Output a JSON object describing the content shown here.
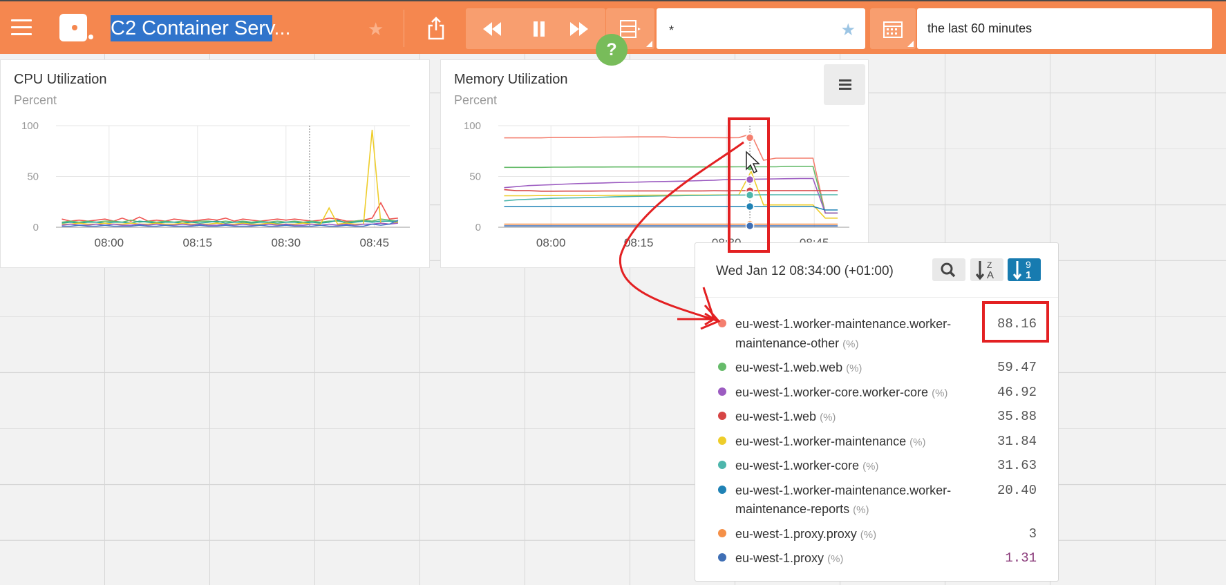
{
  "header": {
    "title": "C2 Container Serv...",
    "filter_query": "*",
    "time_range": "the last 60 minutes",
    "help_label": "?"
  },
  "icons": {
    "menu": "hamburger-menu-icon",
    "logo": "app-logo-icon",
    "favorite": "star-icon",
    "share": "share-icon",
    "rewind": "rewind-icon",
    "pause": "pause-icon",
    "forward": "fast-forward-icon",
    "filter": "filter-panel-icon",
    "calendar": "calendar-icon",
    "search": "search-icon",
    "sort_alpha": "sort-alpha-desc-icon",
    "sort_numeric": "sort-numeric-desc-icon"
  },
  "colors": {
    "topbar": "#f5874f",
    "accent_blue": "#177bb0",
    "annotation_red": "#e32022",
    "help_green": "#78bc5a"
  },
  "panels": [
    {
      "title": "CPU Utilization",
      "subtitle": "Percent",
      "chart_data": {
        "type": "line",
        "y_ticks": [
          "100",
          "50",
          "0"
        ],
        "x_ticks": [
          "08:00",
          "08:15",
          "08:30",
          "08:45"
        ],
        "ylim": [
          0,
          100
        ],
        "x_range": [
          "07:51",
          "08:51"
        ],
        "grid": true,
        "legend": "none",
        "hover_time": "08:34",
        "series": [
          {
            "color": "#ef5350",
            "values": [
              8,
              6,
              7,
              6,
              7,
              8,
              6,
              9,
              6,
              10,
              6,
              7,
              6,
              8,
              7,
              6,
              7,
              8,
              7,
              9,
              6,
              8,
              7,
              6,
              7,
              8,
              7,
              8,
              7,
              6,
              7,
              9,
              8,
              6,
              6,
              7,
              9,
              24,
              8,
              9
            ]
          },
          {
            "color": "#66bb6a",
            "values": [
              5,
              6,
              5,
              6,
              5,
              6,
              6,
              5,
              7,
              5,
              6,
              5,
              6,
              5,
              6,
              5,
              6,
              6,
              5,
              6,
              5,
              6,
              5,
              6,
              5,
              6,
              5,
              6,
              5,
              6,
              5,
              6,
              6,
              5,
              6,
              7,
              6,
              8,
              7,
              6
            ]
          },
          {
            "color": "#26a69a",
            "values": [
              4,
              5,
              4,
              5,
              5,
              4,
              5,
              5,
              4,
              6,
              5,
              4,
              5,
              5,
              4,
              5,
              4,
              5,
              6,
              4,
              5,
              5,
              4,
              5,
              5,
              4,
              5,
              5,
              4,
              5,
              4,
              5,
              7,
              4,
              5,
              6,
              5,
              6,
              6,
              5
            ]
          },
          {
            "color": "#eecd2a",
            "values": [
              3,
              3,
              4,
              3,
              3,
              4,
              3,
              3,
              4,
              3,
              3,
              4,
              3,
              3,
              4,
              3,
              3,
              3,
              4,
              3,
              3,
              4,
              3,
              3,
              4,
              3,
              3,
              3,
              4,
              3,
              3,
              19,
              3,
              4,
              3,
              3,
              96,
              4,
              3,
              5
            ]
          },
          {
            "color": "#9c5cc1",
            "values": [
              2,
              3,
              2,
              2,
              3,
              2,
              3,
              2,
              2,
              3,
              2,
              3,
              2,
              2,
              3,
              2,
              3,
              2,
              2,
              3,
              2,
              3,
              2,
              2,
              3,
              2,
              3,
              2,
              2,
              3,
              2,
              3,
              2,
              3,
              2,
              3,
              3,
              4,
              3,
              4
            ]
          },
          {
            "color": "#4a79c9",
            "values": [
              1,
              1,
              2,
              1,
              1,
              2,
              1,
              1,
              1,
              2,
              1,
              1,
              2,
              1,
              1,
              1,
              2,
              1,
              1,
              2,
              1,
              1,
              1,
              2,
              1,
              1,
              2,
              1,
              1,
              1,
              2,
              1,
              1,
              2,
              1,
              1,
              3,
              2,
              3,
              7
            ]
          }
        ]
      }
    },
    {
      "title": "Memory Utilization",
      "subtitle": "Percent",
      "chart_data": {
        "type": "line",
        "y_ticks": [
          "100",
          "50",
          "0"
        ],
        "x_ticks": [
          "08:00",
          "08:15",
          "08:30",
          "08:45"
        ],
        "ylim": [
          0,
          100
        ],
        "x_range": [
          "07:51",
          "08:51"
        ],
        "grid": true,
        "legend": "none",
        "hover_time": "08:34",
        "series": [
          {
            "color": "#f47f6f",
            "values": [
              88,
              88,
              88,
              88,
              88.5,
              88.5,
              88.5,
              88.5,
              88.8,
              88.8,
              88.9,
              89,
              89,
              89,
              88.2,
              88.2,
              88.2,
              88.2,
              88.16,
              88.2,
              92,
              66,
              68,
              68,
              68,
              68,
              14,
              14
            ]
          },
          {
            "color": "#66bb6a",
            "values": [
              59,
              59,
              59,
              59,
              59.2,
              59.2,
              59.3,
              59.3,
              59.3,
              59.4,
              59.4,
              59.4,
              59.4,
              59.4,
              59.4,
              59.4,
              59.4,
              59.4,
              59.47,
              59.5,
              59.5,
              59.5,
              59.5,
              60,
              60,
              60,
              14,
              14
            ]
          },
          {
            "color": "#9c5cc1",
            "values": [
              39,
              40,
              41,
              41.5,
              42,
              42.5,
              43,
              43.3,
              43.6,
              44,
              44.2,
              44.5,
              44.8,
              45,
              45.3,
              45.6,
              46,
              46.3,
              46.92,
              47,
              47.2,
              47.4,
              47.6,
              47.8,
              48,
              48,
              14,
              14
            ]
          },
          {
            "color": "#d64545",
            "values": [
              37,
              36,
              36,
              35.5,
              35.5,
              35.6,
              35.6,
              35.6,
              35.7,
              35.7,
              35.7,
              35.8,
              35.8,
              35.8,
              35.8,
              35.8,
              35.8,
              35.9,
              35.88,
              36,
              36,
              36,
              36,
              36,
              36,
              36,
              36,
              36
            ]
          },
          {
            "color": "#eecd2a",
            "values": [
              31,
              31,
              31,
              31.2,
              31.2,
              31.3,
              31.3,
              31.4,
              31.4,
              31.5,
              31.5,
              31.5,
              31.6,
              31.6,
              31.6,
              31.7,
              31.7,
              31.8,
              31.84,
              32,
              55,
              22,
              22,
              22,
              22,
              22,
              9,
              9
            ]
          },
          {
            "color": "#4db6ac",
            "values": [
              26,
              27,
              27.5,
              28,
              28.5,
              28.8,
              29,
              29.3,
              29.6,
              30,
              30.2,
              30.5,
              30.7,
              30.9,
              31,
              31.2,
              31.3,
              31.5,
              31.63,
              31.7,
              31.8,
              31.9,
              32,
              32,
              32,
              32,
              32,
              32
            ]
          },
          {
            "color": "#1f82b5",
            "values": [
              20.4,
              20.4,
              20.4,
              20.4,
              20.4,
              20.4,
              20.4,
              20.4,
              20.4,
              20.4,
              20.4,
              20.4,
              20.4,
              20.4,
              20.4,
              20.4,
              20.4,
              20.4,
              20.4,
              20.4,
              20.4,
              20.4,
              20.4,
              20.4,
              20.4,
              20.4,
              17,
              17
            ]
          },
          {
            "color": "#f59048",
            "values": [
              3,
              3,
              3,
              3,
              3,
              3,
              3,
              3,
              3,
              3,
              3,
              3,
              3,
              3,
              3,
              3,
              3,
              3,
              3,
              3,
              3,
              3,
              3,
              3,
              3,
              3,
              3,
              3
            ]
          },
          {
            "color": "#3f6fb5",
            "values": [
              1.3,
              1.3,
              1.3,
              1.3,
              1.3,
              1.3,
              1.3,
              1.3,
              1.3,
              1.3,
              1.3,
              1.3,
              1.3,
              1.3,
              1.3,
              1.3,
              1.3,
              1.3,
              1.31,
              1.3,
              1.3,
              1.3,
              1.3,
              1.3,
              1.3,
              1.3,
              1.3,
              1.3
            ]
          }
        ]
      }
    }
  ],
  "tooltip": {
    "date": "Wed Jan 12 08:34:00 (+01:00)",
    "sort_numeric_top": "9",
    "sort_numeric_bottom": "1",
    "sort_alpha_top": "Z",
    "sort_alpha_bottom": "A",
    "items": [
      {
        "name": "eu-west-1.worker-maintenance.worker-maintenance-other",
        "unit": "(%)",
        "value": "88.16",
        "color": "#f47f6f"
      },
      {
        "name": "eu-west-1.web.web",
        "unit": "(%)",
        "value": "59.47",
        "color": "#66bb6a"
      },
      {
        "name": "eu-west-1.worker-core.worker-core",
        "unit": "(%)",
        "value": "46.92",
        "color": "#9c5cc1"
      },
      {
        "name": "eu-west-1.web",
        "unit": "(%)",
        "value": "35.88",
        "color": "#d64545"
      },
      {
        "name": "eu-west-1.worker-maintenance",
        "unit": "(%)",
        "value": "31.84",
        "color": "#eecd2a"
      },
      {
        "name": "eu-west-1.worker-core",
        "unit": "(%)",
        "value": "31.63",
        "color": "#4db6ac"
      },
      {
        "name": "eu-west-1.worker-maintenance.worker-maintenance-reports",
        "unit": "(%)",
        "value": "20.40",
        "color": "#1f82b5"
      },
      {
        "name": "eu-west-1.proxy.proxy",
        "unit": "(%)",
        "value": "3",
        "color": "#f59048"
      },
      {
        "name": "eu-west-1.proxy",
        "unit": "(%)",
        "value": "1.31",
        "color": "#3f6fb5"
      }
    ]
  }
}
